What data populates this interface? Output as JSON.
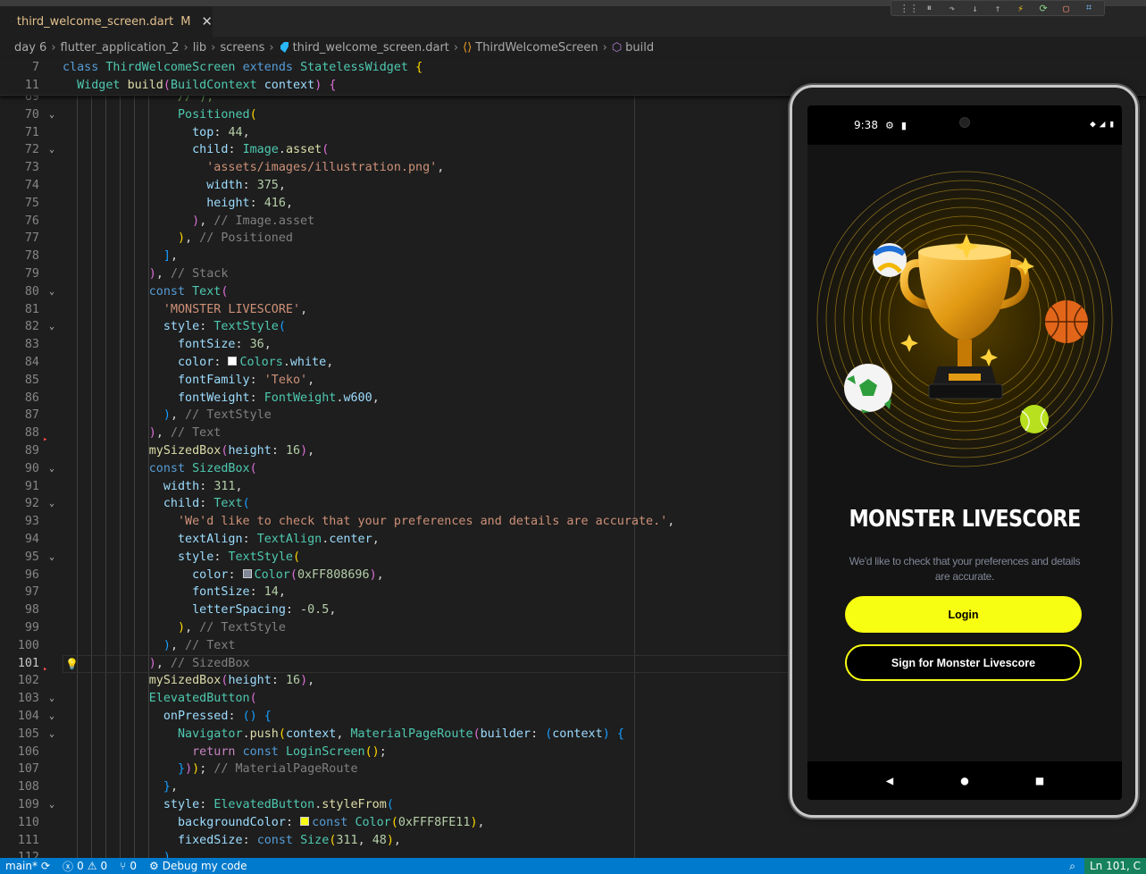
{
  "tab": {
    "title": "third_welcome_screen.dart",
    "modified": "M",
    "close": "✕"
  },
  "breadcrumb": [
    "day 6",
    "flutter_application_2",
    "lib",
    "screens",
    "third_welcome_screen.dart",
    "ThirdWelcomeScreen",
    "build"
  ],
  "sticky": [
    {
      "num": "7",
      "html": "<span class=\"k\">class</span> <span class=\"t\">ThirdWelcomeScreen</span> <span class=\"k\">extends</span> <span class=\"t\">StatelessWidget</span> <span class=\"b1\">{</span>"
    },
    {
      "num": "11",
      "html": "  <span class=\"t\">Widget</span> <span class=\"f\">build</span><span class=\"b2\">(</span><span class=\"t\">BuildContext</span> <span class=\"pr\">context</span><span class=\"b2\">)</span> <span class=\"b2\">{</span>"
    }
  ],
  "code_lines": [
    {
      "num": "69",
      "fold": "",
      "html": "                <span class=\"c\">// ),</span>"
    },
    {
      "num": "70",
      "fold": "⌄",
      "html": "                <span class=\"t\">Positioned</span><span class=\"b1\">(</span>"
    },
    {
      "num": "71",
      "fold": "",
      "html": "                  <span class=\"pr\">top</span>: <span class=\"n\">44</span>,"
    },
    {
      "num": "72",
      "fold": "⌄",
      "html": "                  <span class=\"pr\">child</span>: <span class=\"t\">Image</span>.<span class=\"f\">asset</span><span class=\"b2\">(</span>"
    },
    {
      "num": "73",
      "fold": "",
      "html": "                    <span class=\"s\">'assets/images/illustration.png'</span>,"
    },
    {
      "num": "74",
      "fold": "",
      "html": "                    <span class=\"pr\">width</span>: <span class=\"n\">375</span>,"
    },
    {
      "num": "75",
      "fold": "",
      "html": "                    <span class=\"pr\">height</span>: <span class=\"n\">416</span>,"
    },
    {
      "num": "76",
      "fold": "",
      "html": "                  <span class=\"b2\">)</span>, <span class=\"grey\">// Image.asset</span>"
    },
    {
      "num": "77",
      "fold": "",
      "html": "                <span class=\"b1\">)</span>, <span class=\"grey\">// Positioned</span>"
    },
    {
      "num": "78",
      "fold": "",
      "html": "              <span class=\"b3\">]</span>,"
    },
    {
      "num": "79",
      "fold": "",
      "html": "            <span class=\"b2\">)</span>, <span class=\"grey\">// Stack</span>"
    },
    {
      "num": "80",
      "fold": "⌄",
      "html": "            <span class=\"k\">const</span> <span class=\"t\">Text</span><span class=\"b2\">(</span>"
    },
    {
      "num": "81",
      "fold": "",
      "html": "              <span class=\"s\">'MONSTER LIVESCORE'</span>,"
    },
    {
      "num": "82",
      "fold": "⌄",
      "html": "              <span class=\"pr\">style</span>: <span class=\"t\">TextStyle</span><span class=\"b3\">(</span>"
    },
    {
      "num": "83",
      "fold": "",
      "html": "                <span class=\"pr\">fontSize</span>: <span class=\"n\">36</span>,"
    },
    {
      "num": "84",
      "fold": "",
      "html": "                <span class=\"pr\">color</span>: <span class=\"swatch\" style=\"background:#fff\"></span><span class=\"t\">Colors</span>.<span class=\"pr\">white</span>,"
    },
    {
      "num": "85",
      "fold": "",
      "html": "                <span class=\"pr\">fontFamily</span>: <span class=\"s\">'Teko'</span>,"
    },
    {
      "num": "86",
      "fold": "",
      "html": "                <span class=\"pr\">fontWeight</span>: <span class=\"t\">FontWeight</span>.<span class=\"pr\">w600</span>,"
    },
    {
      "num": "87",
      "fold": "",
      "html": "              <span class=\"b3\">)</span>, <span class=\"grey\">// TextStyle</span>"
    },
    {
      "num": "88",
      "fold": "",
      "html": "            <span class=\"b2\">)</span>, <span class=\"grey\">// Text</span>"
    },
    {
      "num": "89",
      "fold": "",
      "html": "            <span class=\"f\">mySizedBox</span><span class=\"b2\">(</span><span class=\"pr\">height</span>: <span class=\"n\">16</span><span class=\"b2\">)</span>,"
    },
    {
      "num": "90",
      "fold": "⌄",
      "html": "            <span class=\"k\">const</span> <span class=\"t\">SizedBox</span><span class=\"b2\">(</span>"
    },
    {
      "num": "91",
      "fold": "",
      "html": "              <span class=\"pr\">width</span>: <span class=\"n\">311</span>,"
    },
    {
      "num": "92",
      "fold": "⌄",
      "html": "              <span class=\"pr\">child</span>: <span class=\"t\">Text</span><span class=\"b3\">(</span>"
    },
    {
      "num": "93",
      "fold": "",
      "html": "                <span class=\"s\">'We'd like to check that your preferences and details are accurate.'</span>,"
    },
    {
      "num": "94",
      "fold": "",
      "html": "                <span class=\"pr\">textAlign</span>: <span class=\"t\">TextAlign</span>.<span class=\"pr\">center</span>,"
    },
    {
      "num": "95",
      "fold": "⌄",
      "html": "                <span class=\"pr\">style</span>: <span class=\"t\">TextStyle</span><span class=\"b1\">(</span>"
    },
    {
      "num": "96",
      "fold": "",
      "html": "                  <span class=\"pr\">color</span>: <span class=\"swatch\" style=\"background:#808696\"></span><span class=\"t\">Color</span><span class=\"b2\">(</span><span class=\"n\">0xFF808696</span><span class=\"b2\">)</span>,"
    },
    {
      "num": "97",
      "fold": "",
      "html": "                  <span class=\"pr\">fontSize</span>: <span class=\"n\">14</span>,"
    },
    {
      "num": "98",
      "fold": "",
      "html": "                  <span class=\"pr\">letterSpacing</span>: -<span class=\"n\">0.5</span>,"
    },
    {
      "num": "99",
      "fold": "",
      "html": "                <span class=\"b1\">)</span>, <span class=\"grey\">// TextStyle</span>"
    },
    {
      "num": "100",
      "fold": "",
      "html": "              <span class=\"b3\">)</span>, <span class=\"grey\">// Text</span>"
    },
    {
      "num": "101",
      "fold": "",
      "html": "            <span class=\"b2\">)</span>, <span class=\"grey\">// SizedBox</span>"
    },
    {
      "num": "102",
      "fold": "",
      "html": "            <span class=\"f\">mySizedBox</span><span class=\"b2\">(</span><span class=\"pr\">height</span>: <span class=\"n\">16</span><span class=\"b2\">)</span>,"
    },
    {
      "num": "103",
      "fold": "⌄",
      "html": "            <span class=\"t\">ElevatedButton</span><span class=\"b2\">(</span>"
    },
    {
      "num": "104",
      "fold": "⌄",
      "html": "              <span class=\"pr\">onPressed</span>: <span class=\"b3\">()</span> <span class=\"b3\">{</span>"
    },
    {
      "num": "105",
      "fold": "⌄",
      "html": "                <span class=\"t\">Navigator</span>.<span class=\"f\">push</span><span class=\"b1\">(</span><span class=\"pr\">context</span>, <span class=\"t\">MaterialPageRoute</span><span class=\"b2\">(</span><span class=\"pr\">builder</span>: <span class=\"b3\">(</span><span class=\"pr\">context</span><span class=\"b3\">)</span> <span class=\"b3\">{</span>"
    },
    {
      "num": "106",
      "fold": "",
      "html": "                  <span class=\"kw\">return</span> <span class=\"k\">const</span> <span class=\"t\">LoginScreen</span><span class=\"b1\">()</span>;"
    },
    {
      "num": "107",
      "fold": "",
      "html": "                <span class=\"b3\">}</span><span class=\"b2\">)</span><span class=\"b1\">)</span>; <span class=\"grey\">// MaterialPageRoute</span>"
    },
    {
      "num": "108",
      "fold": "",
      "html": "              <span class=\"b3\">}</span>,"
    },
    {
      "num": "109",
      "fold": "⌄",
      "html": "              <span class=\"pr\">style</span>: <span class=\"t\">ElevatedButton</span>.<span class=\"f\">styleFrom</span><span class=\"b3\">(</span>"
    },
    {
      "num": "110",
      "fold": "",
      "html": "                <span class=\"pr\">backgroundColor</span>: <span class=\"swatch\" style=\"background:#f8fe11\"></span><span class=\"k\">const</span> <span class=\"t\">Color</span><span class=\"b1\">(</span><span class=\"n\">0xFFF8FE11</span><span class=\"b1\">)</span>,"
    },
    {
      "num": "111",
      "fold": "",
      "html": "                <span class=\"pr\">fixedSize</span>: <span class=\"k\">const</span> <span class=\"t\">Size</span><span class=\"b1\">(</span><span class=\"n\">311</span>, <span class=\"n\">48</span><span class=\"b1\">)</span>,"
    },
    {
      "num": "112",
      "fold": "",
      "html": "              <span class=\"b3\">)</span>,"
    }
  ],
  "current_line": "101",
  "phone": {
    "time": "9:38",
    "app_title": "MONSTER LIVESCORE",
    "app_subtitle": "We'd like to check that your preferences and details are accurate.",
    "login_label": "Login",
    "signup_label": "Sign for Monster Livescore",
    "accent": "#f8fe11"
  },
  "status": {
    "branch": "main*",
    "errors": "0",
    "warnings": "0",
    "ports": "0",
    "debug": "Debug my code",
    "position": "Ln 101, C"
  },
  "colors": {
    "statusbar": "#007acc",
    "editor_bg": "#1e1e1e"
  }
}
